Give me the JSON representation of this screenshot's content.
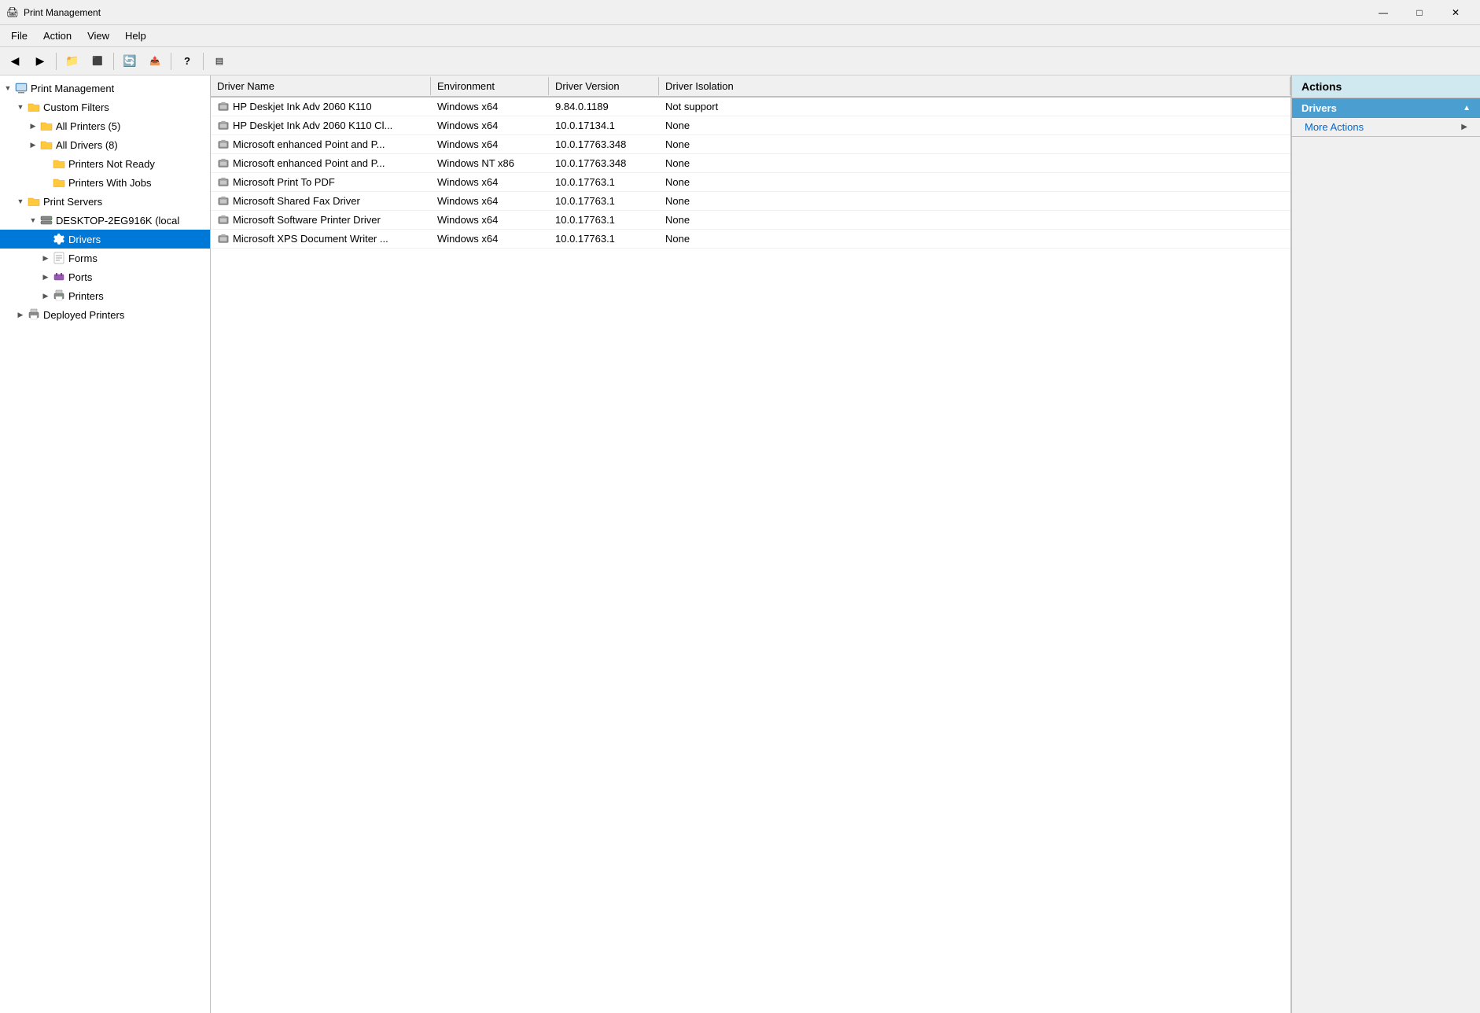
{
  "titleBar": {
    "icon": "🖨",
    "title": "Print Management",
    "minimizeLabel": "—",
    "maximizeLabel": "□",
    "closeLabel": "✕"
  },
  "menuBar": {
    "items": [
      "File",
      "Action",
      "View",
      "Help"
    ]
  },
  "toolbar": {
    "buttons": [
      {
        "name": "back",
        "icon": "←"
      },
      {
        "name": "forward",
        "icon": "→"
      },
      {
        "name": "up",
        "icon": "📁"
      },
      {
        "name": "show-hide",
        "icon": "⬛"
      },
      {
        "name": "refresh",
        "icon": "🔄"
      },
      {
        "name": "export",
        "icon": "📤"
      },
      {
        "name": "help",
        "icon": "?"
      },
      {
        "name": "separator",
        "icon": ""
      },
      {
        "name": "view",
        "icon": "▤"
      }
    ]
  },
  "tree": {
    "items": [
      {
        "id": "print-mgmt",
        "label": "Print Management",
        "level": 0,
        "expanded": true,
        "hasChildren": true,
        "iconType": "computer"
      },
      {
        "id": "custom-filters",
        "label": "Custom Filters",
        "level": 1,
        "expanded": true,
        "hasChildren": true,
        "iconType": "folder"
      },
      {
        "id": "all-printers",
        "label": "All Printers (5)",
        "level": 2,
        "expanded": false,
        "hasChildren": true,
        "iconType": "folder"
      },
      {
        "id": "all-drivers",
        "label": "All Drivers (8)",
        "level": 2,
        "expanded": false,
        "hasChildren": true,
        "iconType": "folder"
      },
      {
        "id": "printers-not-ready",
        "label": "Printers Not Ready",
        "level": 2,
        "expanded": false,
        "hasChildren": false,
        "iconType": "folder"
      },
      {
        "id": "printers-with-jobs",
        "label": "Printers With Jobs",
        "level": 2,
        "expanded": false,
        "hasChildren": false,
        "iconType": "folder"
      },
      {
        "id": "print-servers",
        "label": "Print Servers",
        "level": 1,
        "expanded": true,
        "hasChildren": true,
        "iconType": "folder"
      },
      {
        "id": "desktop",
        "label": "DESKTOP-2EG916K (local",
        "level": 2,
        "expanded": true,
        "hasChildren": true,
        "iconType": "server"
      },
      {
        "id": "drivers",
        "label": "Drivers",
        "level": 3,
        "expanded": false,
        "hasChildren": false,
        "iconType": "gear",
        "selected": true
      },
      {
        "id": "forms",
        "label": "Forms",
        "level": 3,
        "expanded": false,
        "hasChildren": false,
        "iconType": "folder"
      },
      {
        "id": "ports",
        "label": "Ports",
        "level": 3,
        "expanded": false,
        "hasChildren": false,
        "iconType": "port"
      },
      {
        "id": "printers",
        "label": "Printers",
        "level": 3,
        "expanded": false,
        "hasChildren": false,
        "iconType": "printer"
      },
      {
        "id": "deployed-printers",
        "label": "Deployed Printers",
        "level": 1,
        "expanded": false,
        "hasChildren": true,
        "iconType": "folder"
      }
    ]
  },
  "table": {
    "columns": [
      {
        "id": "driver-name",
        "label": "Driver Name"
      },
      {
        "id": "environment",
        "label": "Environment"
      },
      {
        "id": "driver-version",
        "label": "Driver Version"
      },
      {
        "id": "driver-isolation",
        "label": "Driver Isolation"
      }
    ],
    "rows": [
      {
        "driverName": "HP Deskjet Ink Adv 2060 K110",
        "environment": "Windows x64",
        "version": "9.84.0.1189",
        "isolation": "Not support"
      },
      {
        "driverName": "HP Deskjet Ink Adv 2060 K110 Cl...",
        "environment": "Windows x64",
        "version": "10.0.17134.1",
        "isolation": "None"
      },
      {
        "driverName": "Microsoft enhanced Point and P...",
        "environment": "Windows x64",
        "version": "10.0.17763.348",
        "isolation": "None"
      },
      {
        "driverName": "Microsoft enhanced Point and P...",
        "environment": "Windows NT x86",
        "version": "10.0.17763.348",
        "isolation": "None"
      },
      {
        "driverName": "Microsoft Print To PDF",
        "environment": "Windows x64",
        "version": "10.0.17763.1",
        "isolation": "None"
      },
      {
        "driverName": "Microsoft Shared Fax Driver",
        "environment": "Windows x64",
        "version": "10.0.17763.1",
        "isolation": "None"
      },
      {
        "driverName": "Microsoft Software Printer Driver",
        "environment": "Windows x64",
        "version": "10.0.17763.1",
        "isolation": "None"
      },
      {
        "driverName": "Microsoft XPS Document Writer ...",
        "environment": "Windows x64",
        "version": "10.0.17763.1",
        "isolation": "None"
      }
    ]
  },
  "actions": {
    "panelTitle": "Actions",
    "sections": [
      {
        "id": "drivers-section",
        "label": "Drivers",
        "expanded": true,
        "items": [
          {
            "id": "more-actions",
            "label": "More Actions",
            "hasArrow": true
          }
        ]
      }
    ]
  }
}
